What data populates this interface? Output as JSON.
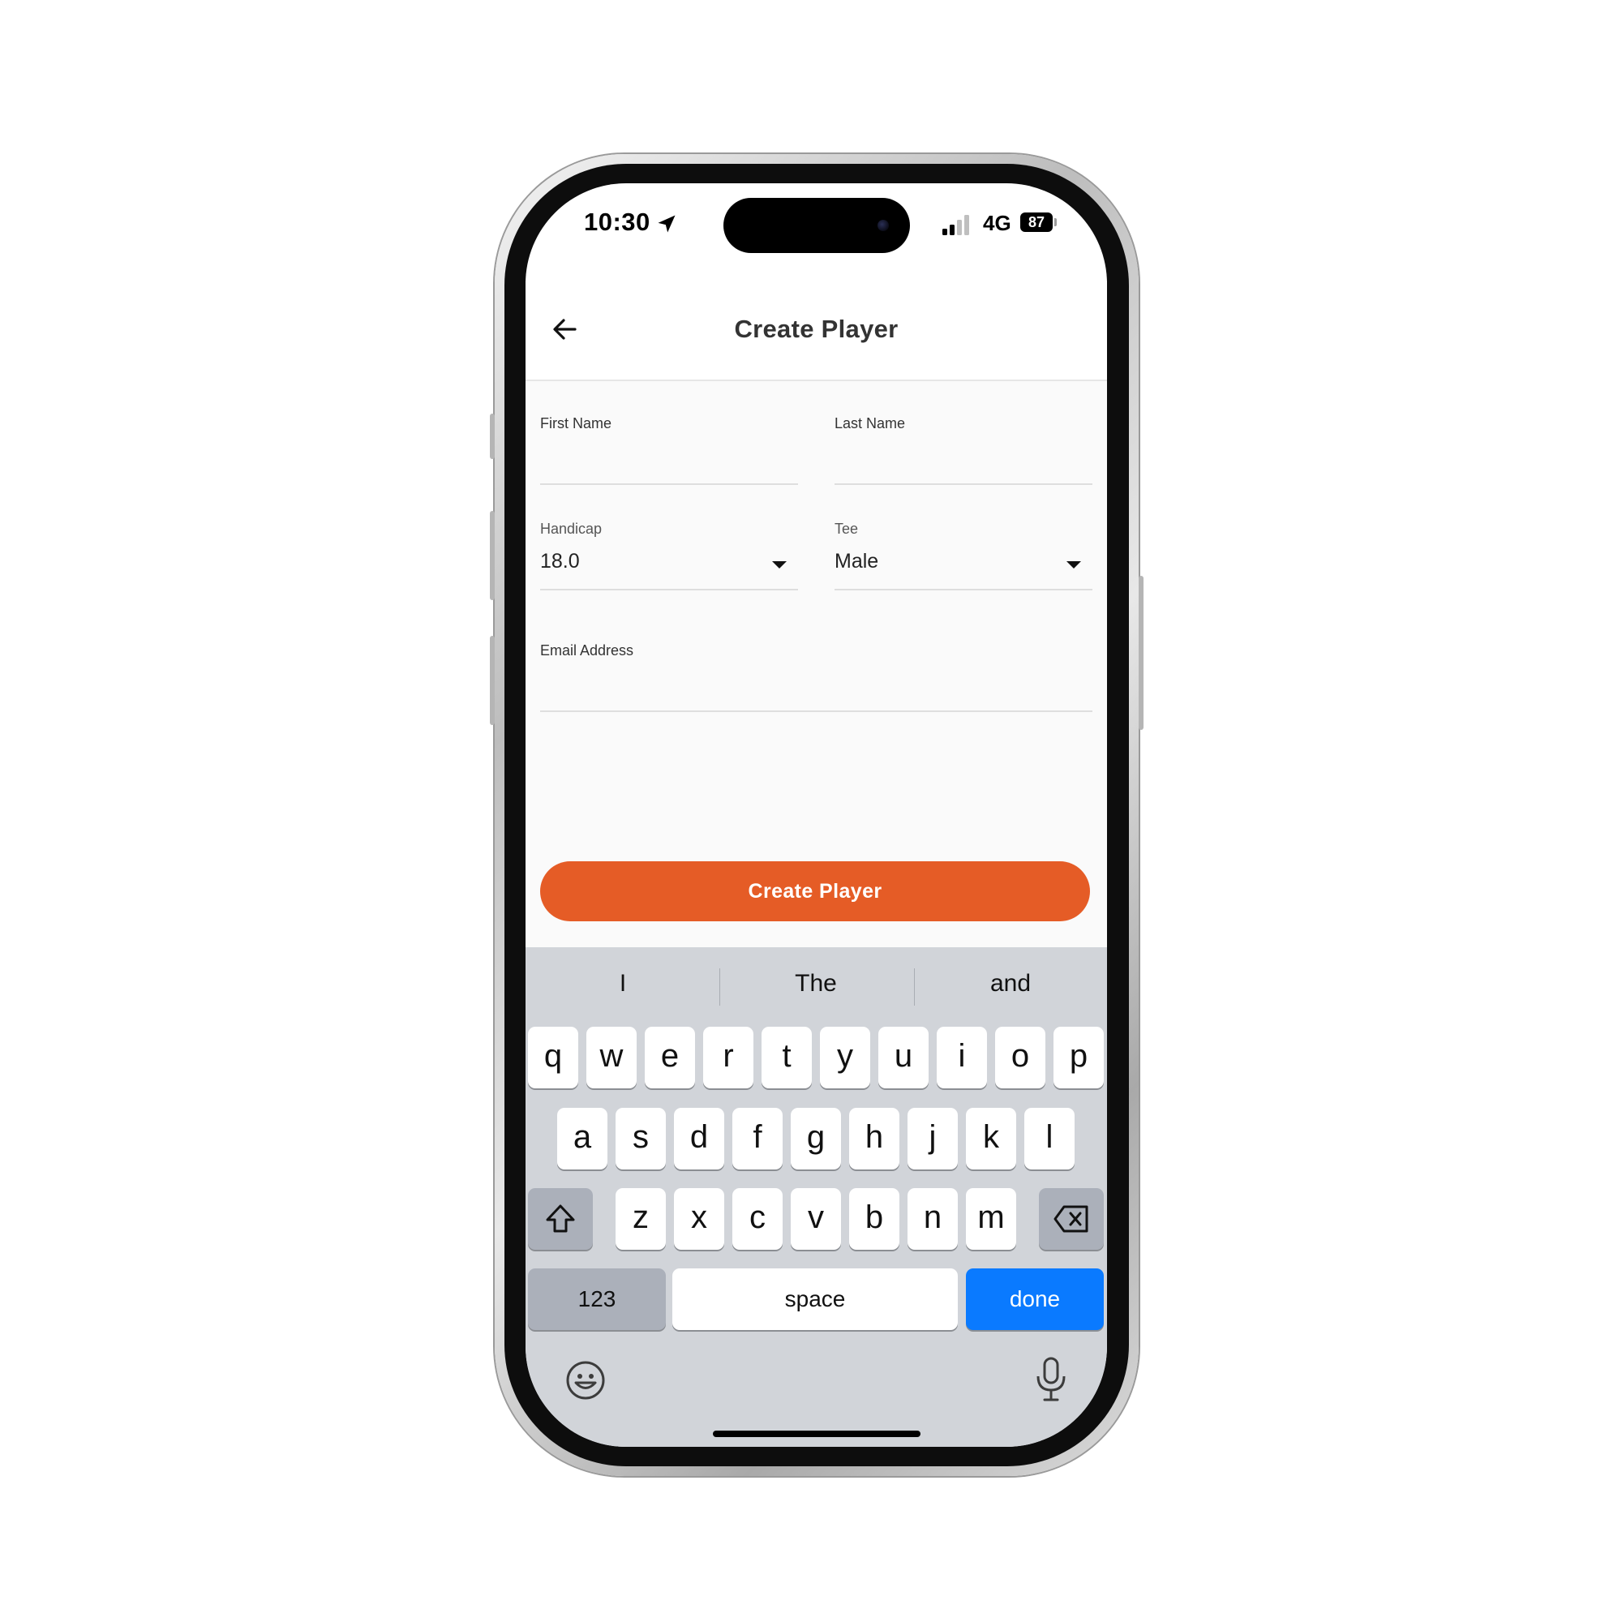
{
  "status_bar": {
    "time": "10:30",
    "network": "4G",
    "battery": "87"
  },
  "header": {
    "title": "Create Player"
  },
  "form": {
    "first_name": {
      "label": "First Name",
      "value": ""
    },
    "last_name": {
      "label": "Last Name",
      "value": ""
    },
    "handicap": {
      "label": "Handicap",
      "value": "18.0"
    },
    "tee": {
      "label": "Tee",
      "value": "Male"
    },
    "email": {
      "label": "Email Address",
      "value": ""
    },
    "submit_label": "Create Player"
  },
  "colors": {
    "accent": "#e55c26",
    "keyboard_done": "#0a7aff"
  },
  "keyboard": {
    "suggestions": [
      "I",
      "The",
      "and"
    ],
    "row1": [
      "q",
      "w",
      "e",
      "r",
      "t",
      "y",
      "u",
      "i",
      "o",
      "p"
    ],
    "row2": [
      "a",
      "s",
      "d",
      "f",
      "g",
      "h",
      "j",
      "k",
      "l"
    ],
    "row3": [
      "z",
      "x",
      "c",
      "v",
      "b",
      "n",
      "m"
    ],
    "numbers_label": "123",
    "space_label": "space",
    "done_label": "done"
  },
  "icons": {
    "back": "arrow-left-icon",
    "shift": "shift-icon",
    "delete": "backspace-icon",
    "emoji": "emoji-icon",
    "mic": "microphone-icon",
    "location": "location-arrow-icon",
    "signal": "cellular-signal-icon"
  }
}
